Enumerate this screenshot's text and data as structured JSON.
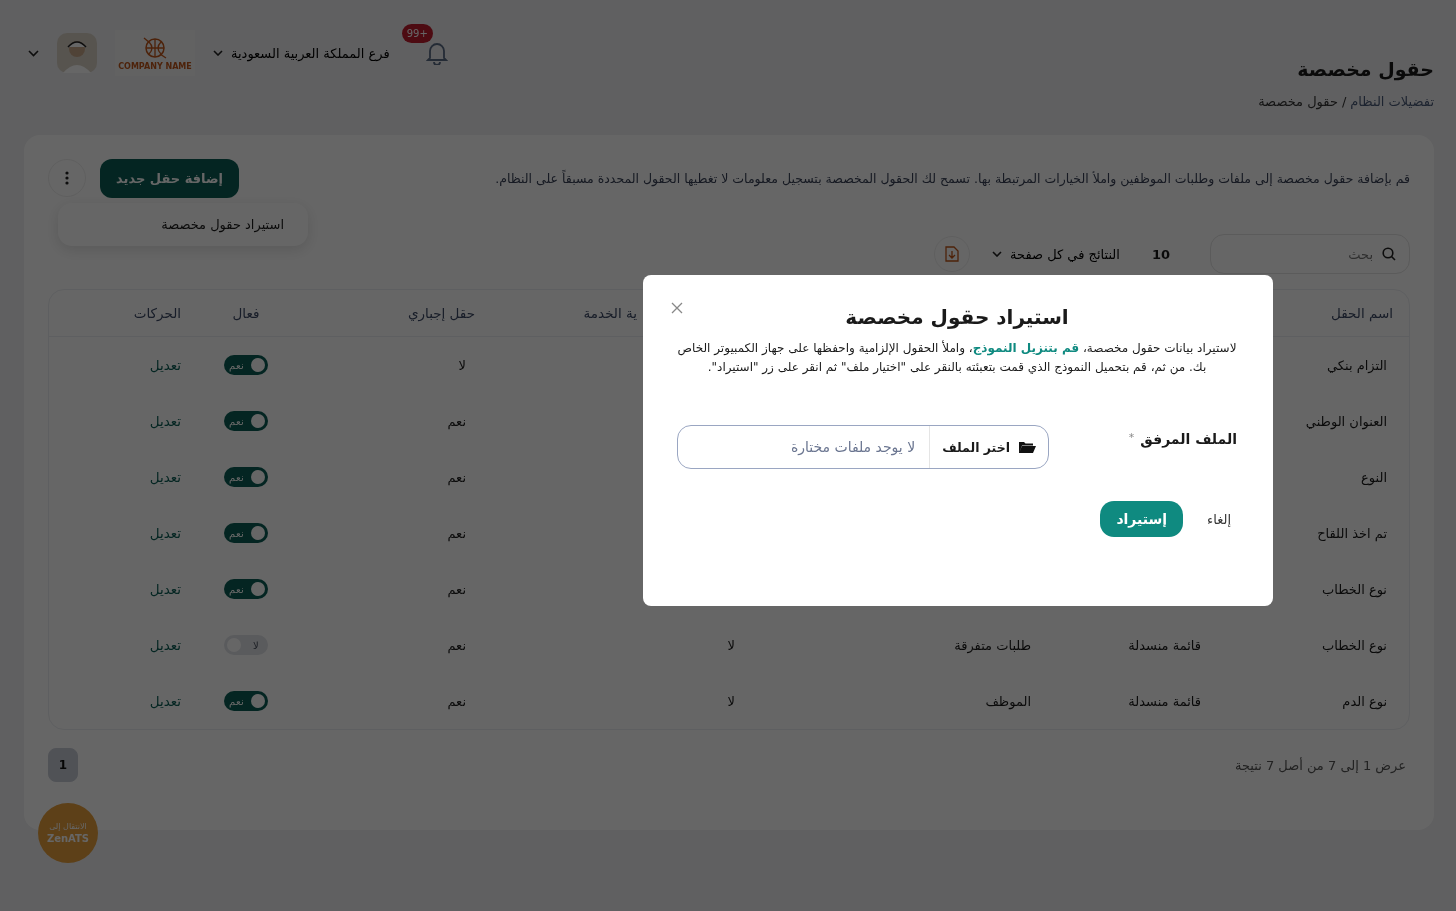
{
  "header": {
    "title": "حقول مخصصة",
    "breadcrumb": [
      {
        "label": "تفضيلات النظام",
        "kind": "link"
      },
      {
        "label": "حقول مخصصة",
        "kind": "current"
      }
    ],
    "breadcrumb_separator": "/",
    "notifications_badge": "+99",
    "branch": "فرع المملكة العربية السعودية",
    "company_logo": "COMPANY NAME"
  },
  "intro": "قم بإضافة حقول مخصصة إلى ملفات وطلبات الموظفين واملأ الخيارات المرتبطة بها. تسمح لك الحقول المخصصة بتسجيل معلومات لا تغطيها الحقول المحددة مسبقاً على النظام.",
  "add_button": "إضافة حقل جديد",
  "menu": {
    "items": [
      "استيراد حقول مخصصة"
    ]
  },
  "search": {
    "placeholder": "بحث"
  },
  "page_size": {
    "value": "10",
    "label": "النتائج في كل صفحة"
  },
  "table": {
    "columns": [
      {
        "label": "اسم الحقل"
      },
      {},
      {},
      {
        "label": "ية الخدمة"
      },
      {
        "label": "حقل إجباري"
      },
      {
        "label": "فعال"
      },
      {
        "label": "الحركات"
      }
    ],
    "rows": [
      {
        "name": "التزام بنكي",
        "mandatory": "لا",
        "active": true,
        "toggle_label": "نعم",
        "action": "تعديل"
      },
      {
        "name": "العنوان الوطني",
        "mandatory": "نعم",
        "active": true,
        "toggle_label": "نعم",
        "action": "تعديل"
      },
      {
        "name": "النوع",
        "mandatory": "نعم",
        "active": true,
        "toggle_label": "نعم",
        "action": "تعديل"
      },
      {
        "name": "تم اخذ اللقاح",
        "mandatory": "نعم",
        "active": true,
        "toggle_label": "نعم",
        "action": "تعديل"
      },
      {
        "name": "نوع الخطاب",
        "mandatory": "نعم",
        "active": true,
        "toggle_label": "نعم",
        "action": "تعديل"
      },
      {
        "name": "نوع الخطاب",
        "column_2": "قائمة منسدلة",
        "column_3": "طلبات متفرقة",
        "column_4": "لا",
        "mandatory": "نعم",
        "active": false,
        "toggle_label": "لا",
        "action": "تعديل"
      },
      {
        "name": "نوع الدم",
        "column_2": "قائمة منسدلة",
        "column_3": "الموظف",
        "column_4": "لا",
        "mandatory": "نعم",
        "active": true,
        "toggle_label": "نعم",
        "action": "تعديل"
      }
    ]
  },
  "pagination": {
    "summary": "عرض 1 إلى 7 من أصل 7 نتيجة",
    "pages": [
      {
        "label": "1",
        "selected": true
      }
    ]
  },
  "zenats_button": {
    "line_1": "الانتقال إلى",
    "line_2": "ZenATS"
  },
  "modal": {
    "title": "استيراد حقول مخصصة",
    "description_before": "لاستيراد بيانات حقول مخصصة، ",
    "description_link": "قم بتنزيل النموذج",
    "description_after": "، واملأ الحقول الإلزامية واحفظها على جهاز الكمبيوتر الخاص بك. من ثم، قم بتحميل النموذج الذي قمت بتعبئته بالنقر على \"اختيار ملف\" ثم انقر على زر \"استيراد\".",
    "file_label": "الملف المرفق",
    "required_mark": "*",
    "choose_button": "اختر الملف",
    "no_file": "لا يوجد ملفات مختارة",
    "submit": "إستيراد",
    "cancel": "إلغاء"
  }
}
